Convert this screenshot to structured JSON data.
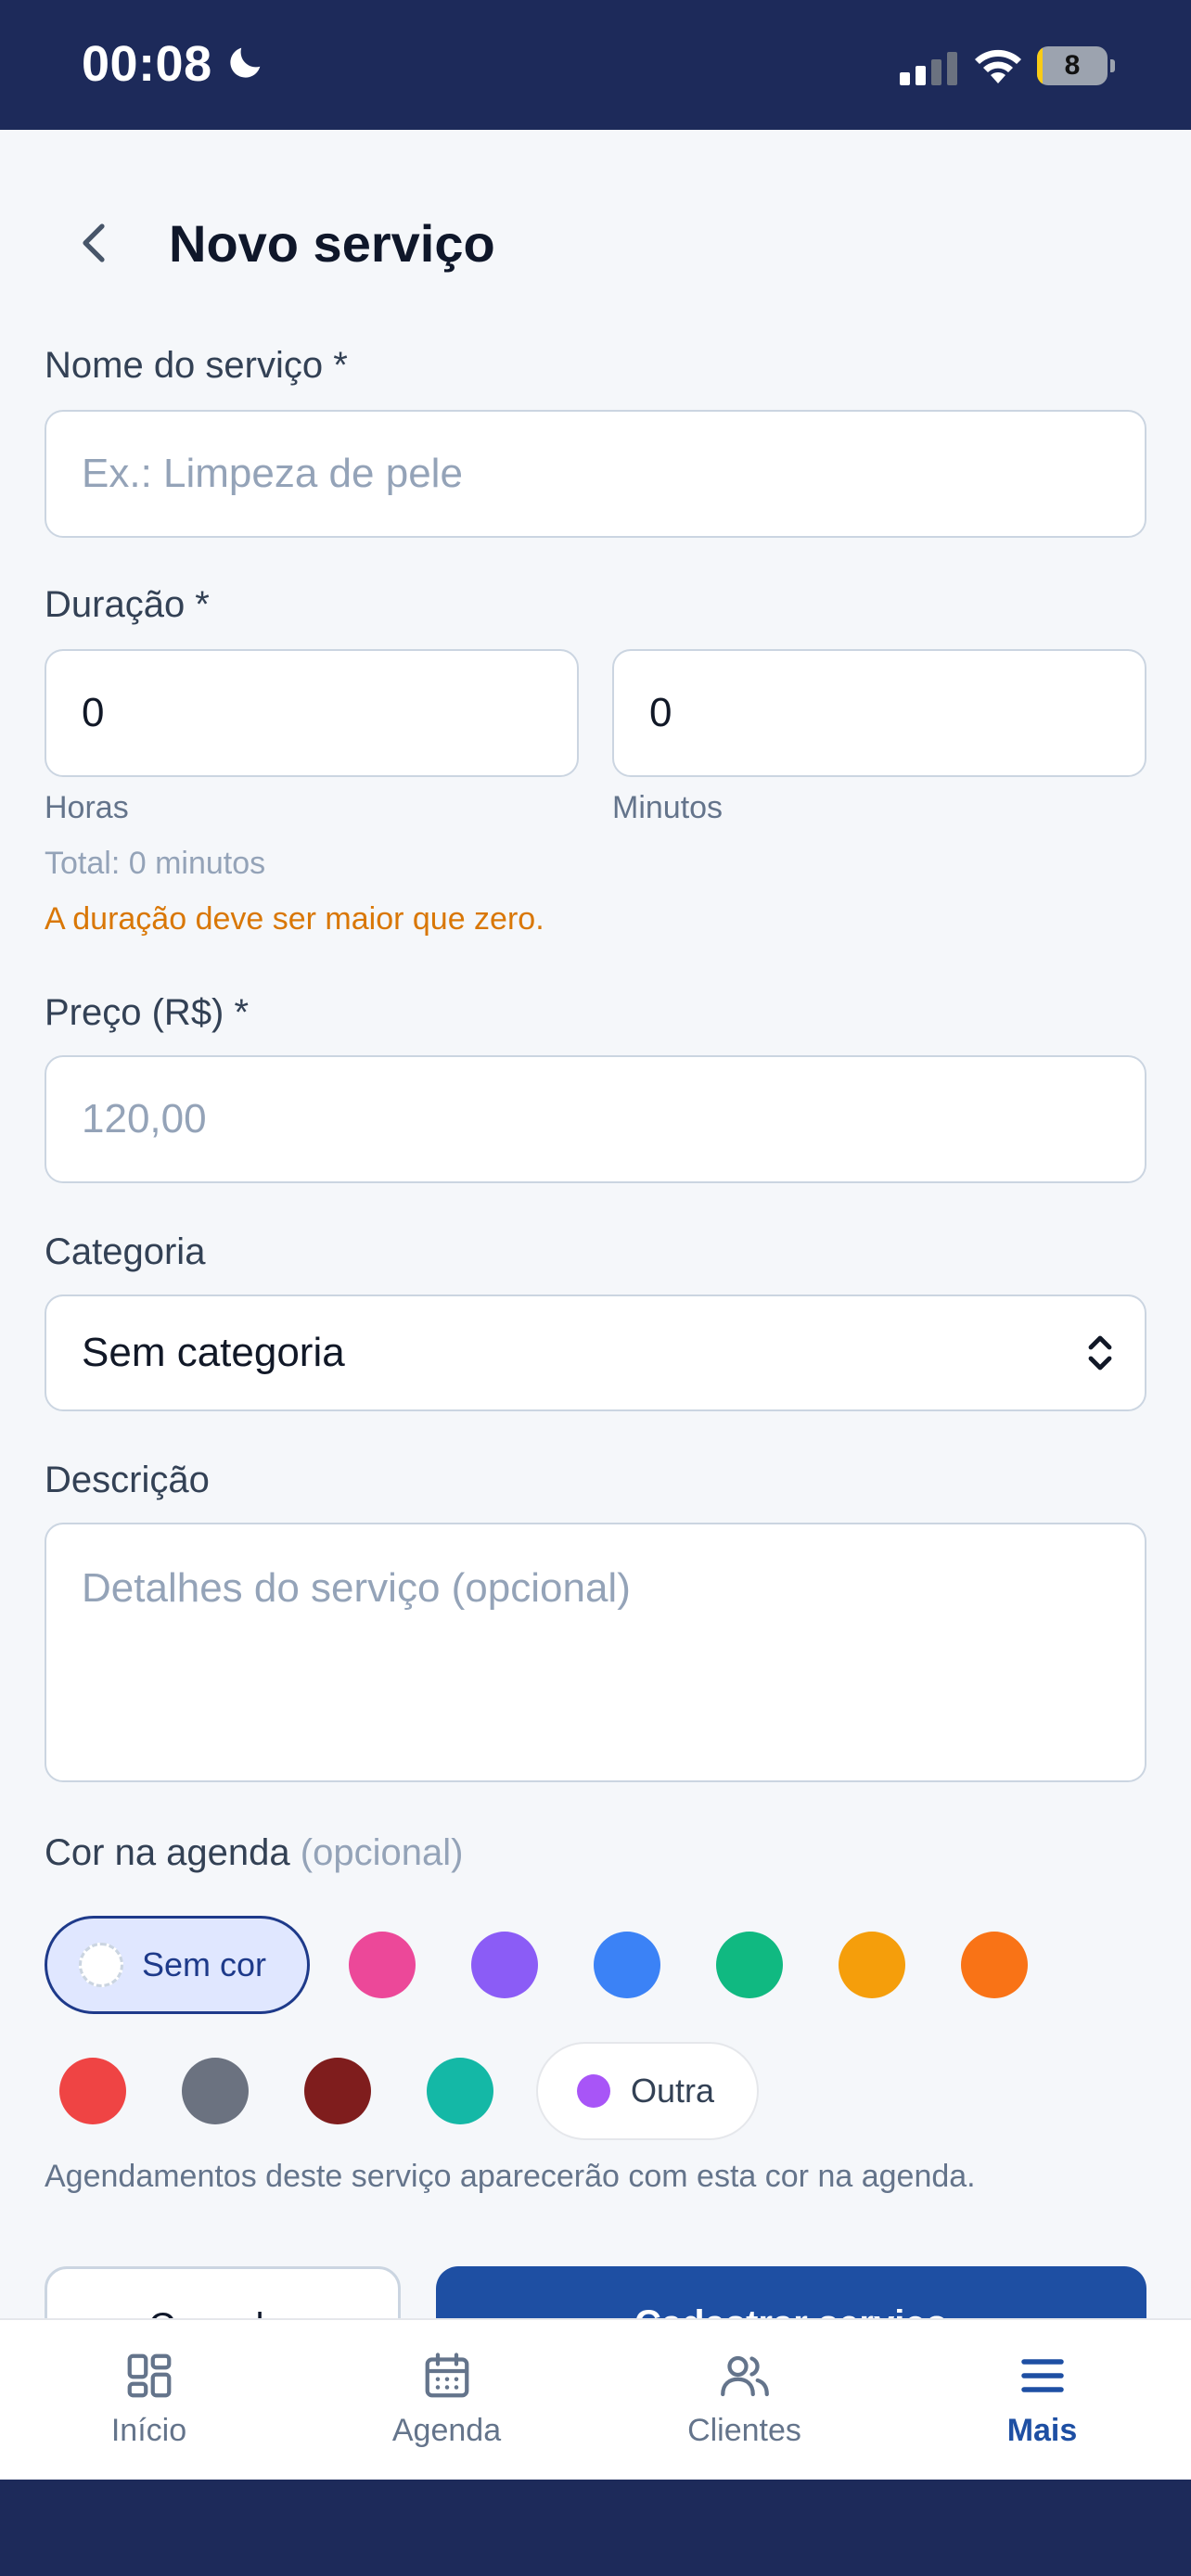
{
  "status_bar": {
    "time": "00:08",
    "battery_level": "8",
    "battery_fraction": 0.08
  },
  "header": {
    "title": "Novo serviço"
  },
  "form": {
    "name": {
      "label": "Nome do serviço *",
      "placeholder": "Ex.: Limpeza de pele",
      "value": ""
    },
    "duration": {
      "label": "Duração *",
      "hours_value": "0",
      "minutes_value": "0",
      "hours_label": "Horas",
      "minutes_label": "Minutos",
      "total_text": "Total: 0 minutos",
      "error_text": "A duração deve ser maior que zero."
    },
    "price": {
      "label": "Preço (R$) *",
      "placeholder": "120,00",
      "value": ""
    },
    "category": {
      "label": "Categoria",
      "selected": "Sem categoria"
    },
    "description": {
      "label": "Descrição",
      "placeholder": "Detalhes do serviço (opcional)",
      "value": ""
    },
    "color": {
      "label": "Cor na agenda",
      "optional_label": "(opcional)",
      "no_color_label": "Sem cor",
      "other_label": "Outra",
      "selected": "Sem cor",
      "swatches": [
        "#ec4899",
        "#8b5cf6",
        "#3b82f6",
        "#10b981",
        "#f59e0b",
        "#f97316",
        "#ef4444",
        "#6b7280",
        "#7f1d1d",
        "#14b8a6"
      ],
      "help_text": "Agendamentos deste serviço aparecerão com esta cor na agenda."
    }
  },
  "actions": {
    "cancel_label": "Cancelar",
    "save_label": "Cadastrar serviço"
  },
  "tabbar": {
    "tabs": [
      {
        "label": "Início",
        "icon": "grid-icon"
      },
      {
        "label": "Agenda",
        "icon": "calendar-icon"
      },
      {
        "label": "Clientes",
        "icon": "users-icon"
      },
      {
        "label": "Mais",
        "icon": "menu-icon"
      }
    ],
    "active": "Mais"
  },
  "colors": {
    "brand": "#1e4fa3",
    "status_bar": "#1d2a5a",
    "warning": "#d97706"
  }
}
